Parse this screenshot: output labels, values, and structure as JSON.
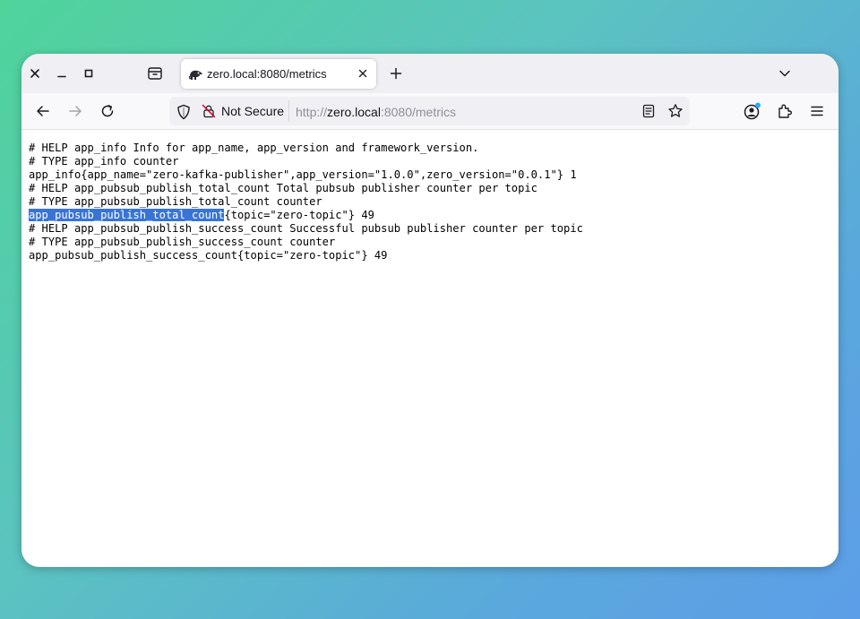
{
  "browser": {
    "tab": {
      "title": "zero.local:8080/metrics",
      "favicon": "chameleon-favicon-icon"
    },
    "window_controls": [
      "close-icon",
      "minimize-icon",
      "maximize-icon"
    ],
    "urlbar": {
      "security_label": "Not Secure",
      "url_prefix": "http://",
      "url_host": "zero.local",
      "url_suffix": ":8080/metrics"
    },
    "colors": {
      "selection": "#3874d8",
      "account_badge": "#2ea8f5"
    }
  },
  "page": {
    "lines": [
      "# HELP app_info Info for app_name, app_version and framework_version.",
      "# TYPE app_info counter",
      "app_info{app_name=\"zero-kafka-publisher\",app_version=\"1.0.0\",zero_version=\"0.0.1\"} 1",
      "# HELP app_pubsub_publish_total_count Total pubsub publisher counter per topic",
      "# TYPE app_pubsub_publish_total_count counter",
      "",
      "# HELP app_pubsub_publish_success_count Successful pubsub publisher counter per topic",
      "# TYPE app_pubsub_publish_success_count counter",
      "app_pubsub_publish_success_count{topic=\"zero-topic\"} 49"
    ],
    "selected_line": {
      "selected_text": "app_pubsub_publish_total_count",
      "rest_text": "{topic=\"zero-topic\"} 49"
    }
  }
}
